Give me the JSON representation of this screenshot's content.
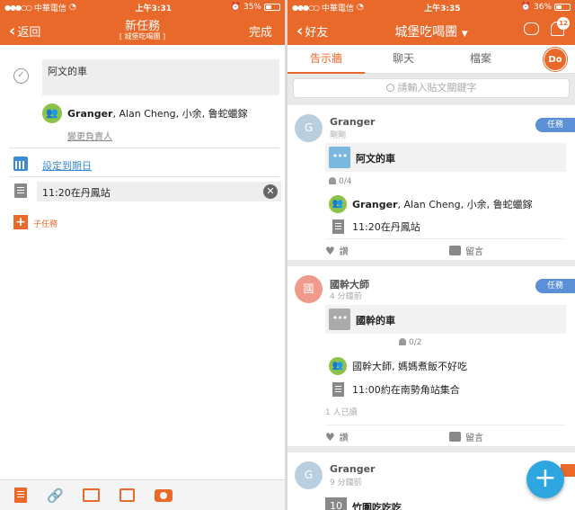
{
  "colors": {
    "accent": "#e8692a",
    "link": "#3b8bd6",
    "fab": "#2ea7e0",
    "task_badge": "#5b8fd6",
    "green_avatar": "#8bc34a"
  },
  "left": {
    "status": {
      "carrier": "中華電信",
      "time": "上午3:31",
      "battery": "35%"
    },
    "nav": {
      "back": "返回",
      "title": "新任務",
      "subtitle": "[ 城堡吃喝團 ]",
      "done": "完成"
    },
    "task_name": "阿文的車",
    "assignees_bold": "Granger",
    "assignees_rest": ", Alan Cheng, 小余, 鲁蛇蠟鎵",
    "change_assignee": "變更負責人",
    "due_date_link": "設定到期日",
    "note": "11:20在丹鳳站",
    "subtask_label": "子任務",
    "bottom_icons": [
      "document-icon",
      "link-icon",
      "upload-icon",
      "image-icon",
      "camera-icon"
    ]
  },
  "right": {
    "status": {
      "carrier": "中華電信",
      "time": "上午3:35",
      "battery": "36%"
    },
    "nav": {
      "back": "好友",
      "title": "城堡吃喝團",
      "badge": "12"
    },
    "tabs": [
      "告示牆",
      "聊天",
      "檔案"
    ],
    "me_avatar": "Do",
    "search_placeholder": "請輸入貼文關鍵字",
    "posts": [
      {
        "avatar": "G",
        "avatar_color": "#b9cfe0",
        "author": "Granger",
        "time": "剛剛",
        "badge": "任務",
        "task_title": "阿文的車",
        "thumb": "•••",
        "thumb_color": "#7ab8e0",
        "count": "0/4",
        "assignees_bold": "Granger",
        "assignees_rest": ", Alan Cheng, 小余, 鲁蛇蠟鎵",
        "note": "11:20在丹鳳站",
        "seen": "",
        "like": "讚",
        "comment": "留言"
      },
      {
        "avatar": "國",
        "avatar_color": "#f09a8c",
        "author": "國幹大師",
        "time": "4 分鐘前",
        "badge": "任務",
        "task_title": "國幹的車",
        "thumb": "•••",
        "thumb_color": "#aaaaaa",
        "count": "0/2",
        "assignees_text": "國幹大師, 媽媽煮飯不好吃",
        "note": "11:00約在南勢角站集合",
        "seen": "1 人已讀",
        "like": "讚",
        "comment": "留言"
      },
      {
        "avatar": "G",
        "avatar_color": "#b9cfe0",
        "author": "Granger",
        "time": "9 分鐘前",
        "thumb": "10",
        "task_title": "竹圍吃吃吃"
      }
    ]
  }
}
